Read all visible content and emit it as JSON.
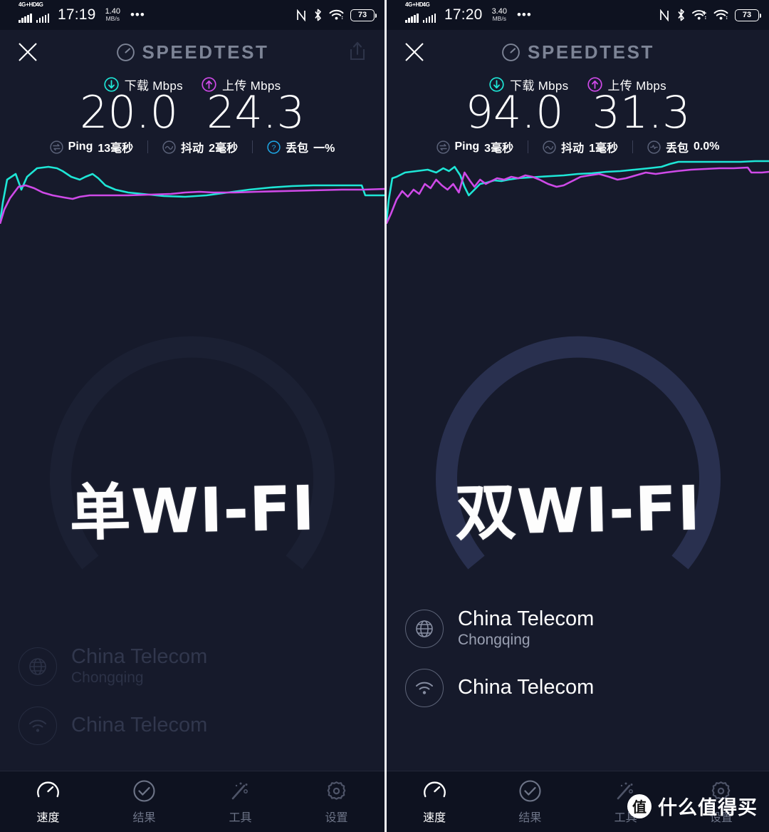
{
  "colors": {
    "background": "#161a2b",
    "statusbar_bg": "#0e1220",
    "download": "#1ee6d6",
    "upload": "#cf4ae8",
    "brand_gray": "#7d8496",
    "ring_active": "#29304f",
    "ring_dim": "#1b2033",
    "text": "#ffffff",
    "dim_text": "#343a50",
    "tab_inactive": "#6d7487"
  },
  "panels": [
    {
      "id": "left",
      "statusbar": {
        "sim1_label": "4G+HD",
        "sim2_label": "4G",
        "time": "17:19",
        "speed_value": "1.40",
        "speed_unit": "MB/s",
        "more": "•••",
        "nfc_icon": "nfc-icon",
        "bluetooth_icon": "bluetooth-icon",
        "wifi_icons": [
          "wifi-icon"
        ],
        "battery": "73"
      },
      "header": {
        "close_icon": "close-icon",
        "logo_icon": "speedometer-icon",
        "brand": "SPEEDTEST",
        "share_icon": "share-icon",
        "share_visible": true,
        "share_dimmed": true
      },
      "metrics": {
        "download_label": "下载 Mbps",
        "upload_label": "上传 Mbps",
        "download_value": "20.0",
        "upload_value": "24.3",
        "download_icon": "download-arrow-icon",
        "upload_icon": "upload-arrow-icon"
      },
      "stats": [
        {
          "icon": "ping-icon",
          "label": "Ping",
          "value": "13毫秒",
          "icon_color": "#5a6178"
        },
        {
          "icon": "jitter-icon",
          "label": "抖动",
          "value": "2毫秒",
          "icon_color": "#5a6178"
        },
        {
          "icon": "help-icon",
          "label": "丢包",
          "value": "一%",
          "icon_color": "#1ea7e6"
        }
      ],
      "overlay_text": "单WI-FI",
      "ring_dimmed": true,
      "isp_dimmed": true,
      "isp": {
        "provider_icon": "globe-icon",
        "provider": "China Telecom",
        "location": "Chongqing",
        "connection_icon": "wifi-circle-icon",
        "connection": "China Telecom"
      },
      "tabs": [
        {
          "icon": "speedometer-icon",
          "label": "速度",
          "active": true
        },
        {
          "icon": "check-circle-icon",
          "label": "结果",
          "active": false
        },
        {
          "icon": "magic-wand-icon",
          "label": "工具",
          "active": false
        },
        {
          "icon": "gear-icon",
          "label": "设置",
          "active": false
        }
      ]
    },
    {
      "id": "right",
      "statusbar": {
        "sim1_label": "4G+HD",
        "sim2_label": "4G",
        "time": "17:20",
        "speed_value": "3.40",
        "speed_unit": "MB/s",
        "more": "•••",
        "nfc_icon": "nfc-icon",
        "bluetooth_icon": "bluetooth-icon",
        "wifi_icons": [
          "wifi-plus-icon",
          "wifi-icon"
        ],
        "battery": "73"
      },
      "header": {
        "close_icon": "close-icon",
        "logo_icon": "speedometer-icon",
        "brand": "SPEEDTEST",
        "share_icon": "share-icon",
        "share_visible": false,
        "share_dimmed": false
      },
      "metrics": {
        "download_label": "下载 Mbps",
        "upload_label": "上传 Mbps",
        "download_value": "94.0",
        "upload_value": "31.3",
        "download_icon": "download-arrow-icon",
        "upload_icon": "upload-arrow-icon"
      },
      "stats": [
        {
          "icon": "ping-icon",
          "label": "Ping",
          "value": "3毫秒",
          "icon_color": "#5a6178"
        },
        {
          "icon": "jitter-icon",
          "label": "抖动",
          "value": "1毫秒",
          "icon_color": "#5a6178"
        },
        {
          "icon": "loss-icon",
          "label": "丢包",
          "value": "0.0%",
          "icon_color": "#5a6178"
        }
      ],
      "overlay_text": "双WI-FI",
      "ring_dimmed": false,
      "isp_dimmed": false,
      "isp": {
        "provider_icon": "globe-icon",
        "provider": "China Telecom",
        "location": "Chongqing",
        "connection_icon": "wifi-circle-icon",
        "connection": "China Telecom"
      },
      "tabs": [
        {
          "icon": "speedometer-icon",
          "label": "速度",
          "active": true
        },
        {
          "icon": "check-circle-icon",
          "label": "结果",
          "active": false
        },
        {
          "icon": "magic-wand-icon",
          "label": "工具",
          "active": false
        },
        {
          "icon": "gear-icon",
          "label": "设置",
          "active": false
        }
      ]
    }
  ],
  "watermark": {
    "badge": "值",
    "text": "什么值得买"
  },
  "chart_data": [
    {
      "id": "left-graph",
      "type": "line",
      "title": "",
      "xlabel": "",
      "ylabel": "Mbps",
      "grid": false,
      "legend": "none",
      "series": [
        {
          "name": "下载",
          "color": "#1ee6d6",
          "x": [
            0,
            2,
            4,
            6,
            8,
            10,
            12,
            14,
            16,
            18,
            20,
            24,
            28,
            32,
            36,
            40,
            46,
            52,
            58,
            64,
            70,
            76,
            82,
            88,
            94,
            100
          ],
          "y": [
            2,
            58,
            84,
            64,
            90,
            92,
            90,
            92,
            86,
            78,
            86,
            74,
            68,
            63,
            61,
            60,
            60,
            61,
            63,
            68,
            72,
            74,
            75,
            76,
            76,
            62
          ]
        },
        {
          "name": "上传",
          "color": "#cf4ae8",
          "x": [
            0,
            2,
            4,
            6,
            8,
            10,
            12,
            14,
            18,
            22,
            26,
            30,
            36,
            42,
            50,
            58,
            66,
            74,
            82,
            90,
            100
          ],
          "y": [
            0,
            38,
            56,
            55,
            50,
            46,
            42,
            40,
            38,
            44,
            45,
            45,
            44,
            45,
            46,
            46,
            47,
            48,
            49,
            50,
            51
          ]
        }
      ]
    },
    {
      "id": "right-graph",
      "type": "line",
      "title": "",
      "xlabel": "",
      "ylabel": "Mbps",
      "grid": false,
      "legend": "none",
      "series": [
        {
          "name": "下载",
          "color": "#1ee6d6",
          "x": [
            0,
            1,
            3,
            5,
            8,
            12,
            15,
            18,
            21,
            24,
            27,
            30,
            34,
            38,
            44,
            50,
            56,
            62,
            68,
            74,
            78,
            80,
            90,
            96,
            100
          ],
          "y": [
            10,
            62,
            74,
            82,
            84,
            88,
            86,
            90,
            86,
            88,
            62,
            78,
            72,
            72,
            74,
            76,
            78,
            80,
            84,
            86,
            88,
            96,
            96,
            96,
            97
          ]
        },
        {
          "name": "上传",
          "color": "#cf4ae8",
          "x": [
            0,
            2,
            5,
            8,
            11,
            14,
            17,
            20,
            23,
            26,
            29,
            32,
            36,
            40,
            44,
            48,
            52,
            56,
            60,
            64,
            70,
            76,
            80,
            90,
            96,
            100
          ],
          "y": [
            2,
            22,
            40,
            34,
            48,
            54,
            48,
            56,
            52,
            46,
            72,
            58,
            66,
            62,
            70,
            74,
            68,
            62,
            68,
            74,
            78,
            80,
            84,
            86,
            90,
            90
          ]
        }
      ]
    }
  ]
}
